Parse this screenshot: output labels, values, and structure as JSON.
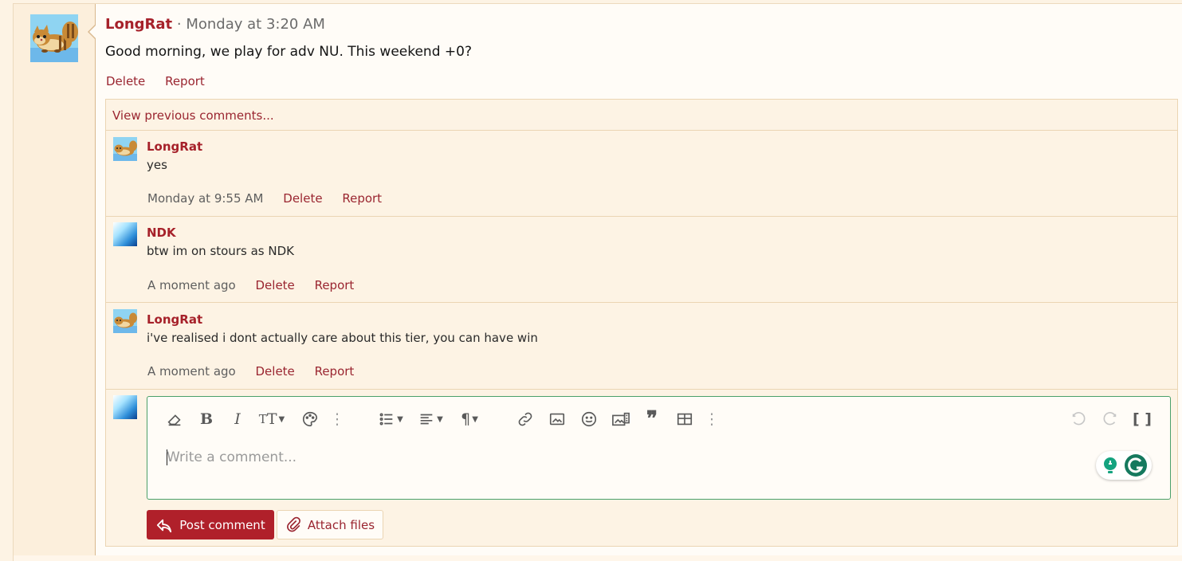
{
  "post": {
    "username": "LongRat",
    "separator": "·",
    "timestamp": "Monday at 3:20 AM",
    "body": "Good morning, we play for adv NU. This weekend +0?",
    "actions": {
      "delete": "Delete",
      "report": "Report"
    }
  },
  "comments": {
    "view_previous": "View previous comments...",
    "items": [
      {
        "username": "LongRat",
        "text": "yes",
        "time": "Monday at 9:55 AM",
        "delete": "Delete",
        "report": "Report",
        "avatar": "longrat-avatar"
      },
      {
        "username": "NDK",
        "text": "btw im on stours as NDK",
        "time": "A moment ago",
        "delete": "Delete",
        "report": "Report",
        "avatar": "ndk-avatar"
      },
      {
        "username": "LongRat",
        "text": "i've realised i dont actually care about this tier, you can have win",
        "time": "A moment ago",
        "delete": "Delete",
        "report": "Report",
        "avatar": "longrat-avatar"
      }
    ]
  },
  "editor": {
    "placeholder": "Write a comment...",
    "toolbar_icons": [
      "eraser-icon",
      "bold-icon",
      "italic-icon",
      "text-size-icon",
      "palette-icon",
      "more-icon",
      "list-icon",
      "align-icon",
      "paragraph-icon",
      "link-icon",
      "image-icon",
      "smiley-icon",
      "media-icon",
      "quote-icon",
      "table-icon",
      "more-icon",
      "undo-icon",
      "redo-icon",
      "bbcode-icon"
    ]
  },
  "buttons": {
    "post_comment": "Post comment",
    "attach_files": "Attach files"
  },
  "colors": {
    "accent": "#a6212a",
    "button": "#b0202a",
    "link": "#9a2530",
    "editor_border": "#4aa06a"
  }
}
